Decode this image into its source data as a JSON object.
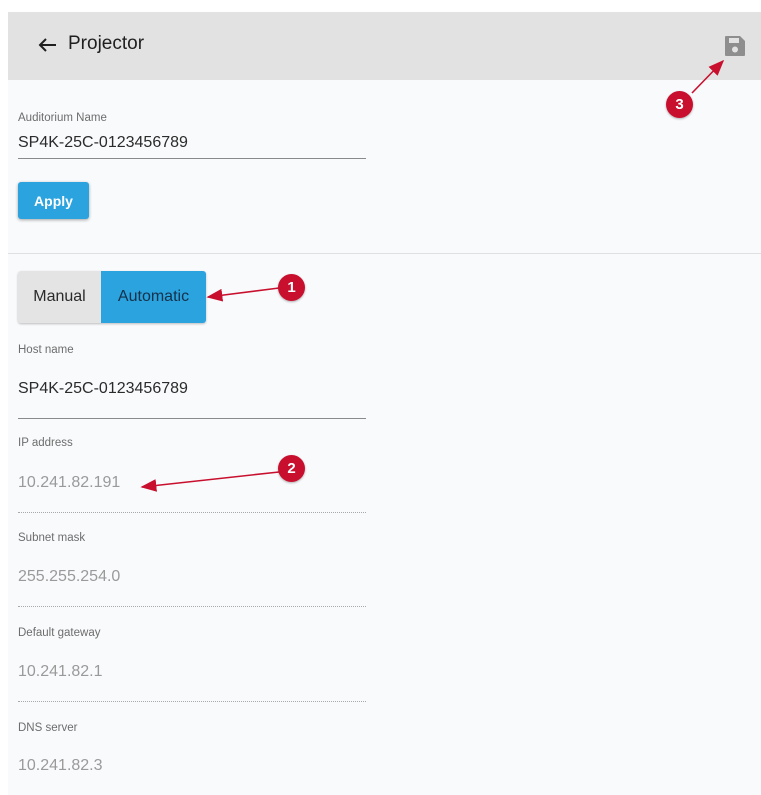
{
  "header": {
    "title": "Projector",
    "back_icon": "arrow-left-icon",
    "save_icon": "floppy-disk-icon"
  },
  "auditorium": {
    "label": "Auditorium Name",
    "value": "SP4K-25C-0123456789",
    "apply_label": "Apply"
  },
  "mode_toggle": {
    "options": [
      "Manual",
      "Automatic"
    ],
    "selected": "Automatic"
  },
  "fields": [
    {
      "label": "Host name",
      "value": "SP4K-25C-0123456789",
      "editable": true
    },
    {
      "label": "IP address",
      "value": "10.241.82.191",
      "editable": false
    },
    {
      "label": "Subnet mask",
      "value": "255.255.254.0",
      "editable": false
    },
    {
      "label": "Default gateway",
      "value": "10.241.82.1",
      "editable": false
    },
    {
      "label": "DNS server",
      "value": "10.241.82.3",
      "editable": false
    }
  ],
  "callouts": [
    "1",
    "2",
    "3"
  ],
  "colors": {
    "accent": "#2aa3df",
    "header_bg": "#e2e2e2",
    "callout": "#c8102e",
    "page_bg": "#f9fafc"
  }
}
